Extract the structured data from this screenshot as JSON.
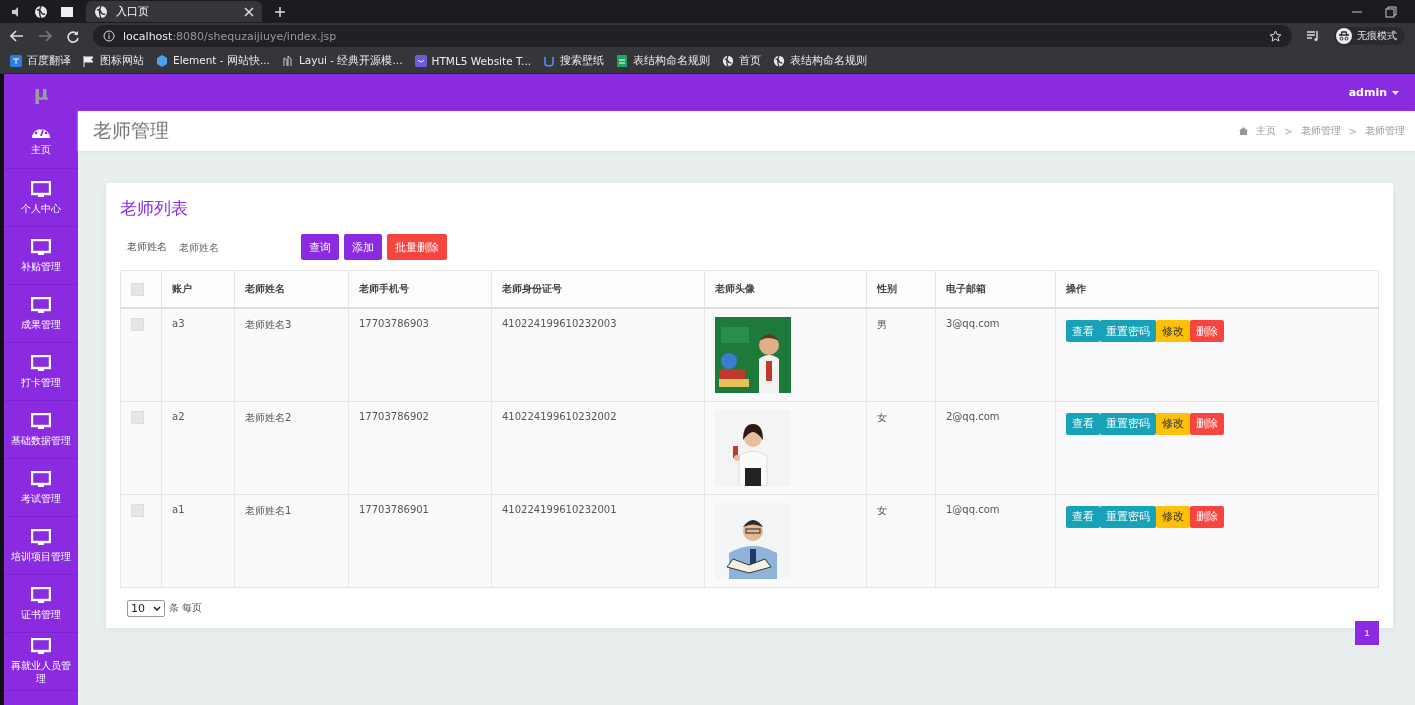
{
  "browser": {
    "tabs": [
      {
        "label": "入口页",
        "selected": true
      }
    ],
    "url_host": "localhost",
    "url_rest": ":8080/shequzaijiuye/index.jsp",
    "bookmarks": [
      {
        "label": "百度翻译",
        "kind": "translate"
      },
      {
        "label": "图标网站",
        "kind": "flag"
      },
      {
        "label": "Element - 网站快...",
        "kind": "hex"
      },
      {
        "label": "Layui - 经典开源模...",
        "kind": "layui"
      },
      {
        "label": "HTML5 Website T...",
        "kind": "html5"
      },
      {
        "label": "搜索壁纸",
        "kind": "wallpaper"
      },
      {
        "label": "表结构命名规则",
        "kind": "sheet"
      },
      {
        "label": "首页",
        "kind": "globe"
      },
      {
        "label": "表结构命名规则",
        "kind": "globe"
      }
    ],
    "profile": "无痕模式"
  },
  "app": {
    "logo": "μ",
    "user": "admin"
  },
  "sidebar": {
    "items": [
      {
        "label": "主页",
        "kind": "dashboard"
      },
      {
        "label": "个人中心",
        "kind": "monitor"
      },
      {
        "label": "补贴管理",
        "kind": "monitor"
      },
      {
        "label": "成果管理",
        "kind": "monitor"
      },
      {
        "label": "打卡管理",
        "kind": "monitor"
      },
      {
        "label": "基础数据管理",
        "kind": "monitor"
      },
      {
        "label": "考试管理",
        "kind": "monitor"
      },
      {
        "label": "培训项目管理",
        "kind": "monitor"
      },
      {
        "label": "证书管理",
        "kind": "monitor"
      },
      {
        "label": "再就业人员管理",
        "kind": "monitor"
      }
    ]
  },
  "page_title": "老师管理",
  "breadcrumb": [
    {
      "kind": "link",
      "text": "主页"
    },
    {
      "kind": "separator",
      "text": ">"
    },
    {
      "kind": "link",
      "text": "老师管理"
    },
    {
      "kind": "separator",
      "text": ">"
    },
    {
      "kind": "link",
      "text": "老师管理"
    }
  ],
  "card_title": "老师列表",
  "search": {
    "label": "老师姓名",
    "placeholder": "老师姓名"
  },
  "toolbar": [
    {
      "label": "查询",
      "kind": "primary"
    },
    {
      "label": "添加",
      "kind": "primary"
    },
    {
      "label": "批量删除",
      "kind": "danger"
    }
  ],
  "table": {
    "columns": [
      "账户",
      "老师姓名",
      "老师手机号",
      "老师身份证号",
      "老师头像",
      "性别",
      "电子邮箱",
      "操作"
    ],
    "header_checked": false,
    "rows": [
      {
        "checked": false,
        "account": "a3",
        "name": "老师姓名3",
        "phone": "17703786903",
        "id_number": "410224199610232003",
        "avatar": {
          "kind": "picture"
        },
        "gender": "男",
        "email": "3@qq.com",
        "actions": [
          {
            "label": "查看",
            "kind": "info"
          },
          {
            "label": "重置密码",
            "kind": "info"
          },
          {
            "label": "修改",
            "kind": "warning"
          },
          {
            "label": "删除",
            "kind": "danger"
          }
        ]
      },
      {
        "checked": false,
        "account": "a2",
        "name": "老师姓名2",
        "phone": "17703786902",
        "id_number": "410224199610232002",
        "avatar": {
          "kind": "picture"
        },
        "gender": "女",
        "email": "2@qq.com",
        "actions": [
          {
            "label": "查看",
            "kind": "info"
          },
          {
            "label": "重置密码",
            "kind": "info"
          },
          {
            "label": "修改",
            "kind": "warning"
          },
          {
            "label": "删除",
            "kind": "danger"
          }
        ]
      },
      {
        "checked": false,
        "account": "a1",
        "name": "老师姓名1",
        "phone": "17703786901",
        "id_number": "410224199610232001",
        "avatar": {
          "kind": "picture"
        },
        "gender": "女",
        "email": "1@qq.com",
        "actions": [
          {
            "label": "查看",
            "kind": "info"
          },
          {
            "label": "重置密码",
            "kind": "info"
          },
          {
            "label": "修改",
            "kind": "warning"
          },
          {
            "label": "删除",
            "kind": "danger"
          }
        ]
      }
    ]
  },
  "pager": {
    "page_size": "10",
    "page_size_suffix": "条 每页",
    "pages": [
      {
        "label": "1",
        "selected": true
      }
    ]
  }
}
